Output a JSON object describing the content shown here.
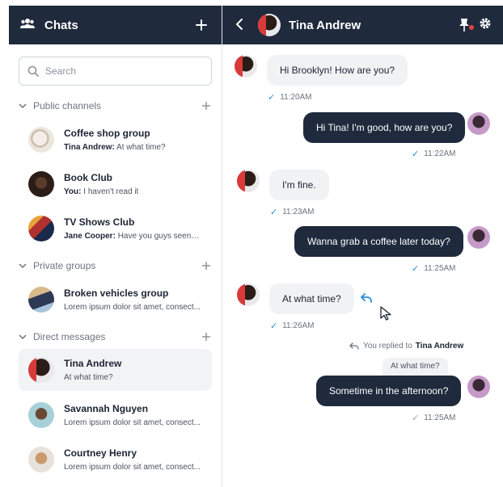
{
  "sidebar": {
    "title": "Chats",
    "search_placeholder": "Search",
    "sections": {
      "public": "Public channels",
      "private": "Private groups",
      "direct": "Direct messages"
    },
    "items": [
      {
        "name": "Coffee shop group",
        "sender": "Tina Andrew:",
        "preview": "At what time?"
      },
      {
        "name": "Book Club",
        "sender": "You:",
        "preview": "I haven't read it"
      },
      {
        "name": "TV Shows Club",
        "sender": "Jane Cooper:",
        "preview": "Have you guys seen the..."
      },
      {
        "name": "Broken vehicles group",
        "sender": "",
        "preview": "Lorem ipsum dolor sit amet, consect..."
      },
      {
        "name": "Tina Andrew",
        "sender": "",
        "preview": "At what time?"
      },
      {
        "name": "Savannah Nguyen",
        "sender": "",
        "preview": "Lorem ipsum dolor sit amet, consect..."
      },
      {
        "name": "Courtney Henry",
        "sender": "",
        "preview": "Lorem ipsum dolor sit amet, consect..."
      }
    ]
  },
  "chat": {
    "title": "Tina Andrew",
    "messages": [
      {
        "text": "Hi Brooklyn! How are you?",
        "time": "11:20AM"
      },
      {
        "text": "Hi Tina! I'm good, how are you?",
        "time": "11:22AM"
      },
      {
        "text": "I'm fine.",
        "time": "11:23AM"
      },
      {
        "text": "Wanna grab a coffee later today?",
        "time": "11:25AM"
      },
      {
        "text": "At what time?",
        "time": "11:26AM"
      },
      {
        "text": "Sometime in the afternoon?",
        "time": "11:25AM"
      }
    ],
    "reply_note_prefix": "You replied to",
    "reply_note_name": "Tina Andrew",
    "reply_quote": "At what time?"
  },
  "icons": {
    "users": "users-icon",
    "add": "plus-icon",
    "search": "search-icon",
    "chevron": "chevron-down-icon",
    "back": "chevron-left-icon",
    "pin": "pin-icon",
    "settings": "gear-icon",
    "reply": "reply-icon",
    "read": "check-icon",
    "cursor": "cursor-icon"
  },
  "colors": {
    "header": "#1f2a3d",
    "incoming_bubble": "#f1f2f4",
    "outgoing_bubble": "#1f2a3d",
    "read_check": "#2a8cd7",
    "pin_dot": "#e34141"
  }
}
